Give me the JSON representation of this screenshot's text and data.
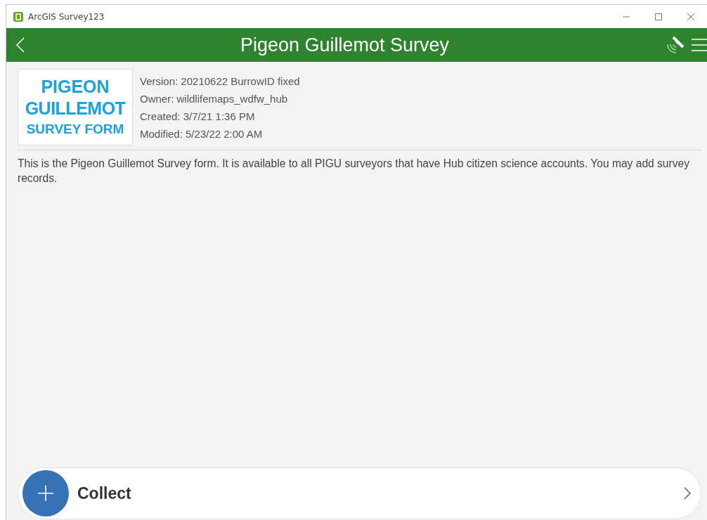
{
  "window": {
    "title": "ArcGIS Survey123"
  },
  "header": {
    "title": "Pigeon Guillemot Survey"
  },
  "thumbnail": {
    "lines": [
      "PIGEON",
      "GUILLEMOT",
      "SURVEY FORM"
    ]
  },
  "meta": [
    "Version: 20210622 BurrowID fixed",
    "Owner: wildlifemaps_wdfw_hub",
    "Created: 3/7/21 1:36 PM",
    "Modified: 5/23/22 2:00 AM"
  ],
  "description": "This is the Pigeon Guillemot Survey form. It is available to all PIGU surveyors that have Hub citizen science accounts. You may add survey records.",
  "collect": {
    "label": "Collect"
  }
}
